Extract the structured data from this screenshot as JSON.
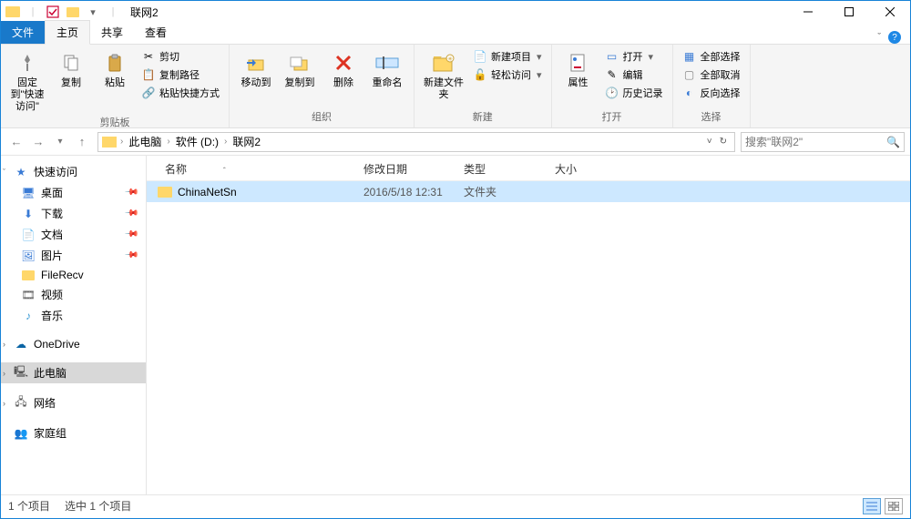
{
  "window": {
    "title": "联网2"
  },
  "tabs": {
    "file": "文件",
    "home": "主页",
    "share": "共享",
    "view": "查看"
  },
  "ribbon": {
    "clipboard": {
      "pin": "固定到\"快速访问\"",
      "copy": "复制",
      "paste": "粘贴",
      "cut": "剪切",
      "copy_path": "复制路径",
      "paste_shortcut": "粘贴快捷方式",
      "label": "剪贴板"
    },
    "organize": {
      "move_to": "移动到",
      "copy_to": "复制到",
      "delete": "删除",
      "rename": "重命名",
      "label": "组织"
    },
    "new": {
      "new_folder": "新建文件夹",
      "new_item": "新建项目",
      "easy_access": "轻松访问",
      "label": "新建"
    },
    "open": {
      "properties": "属性",
      "open": "打开",
      "edit": "编辑",
      "history": "历史记录",
      "label": "打开"
    },
    "select": {
      "select_all": "全部选择",
      "select_none": "全部取消",
      "invert": "反向选择",
      "label": "选择"
    }
  },
  "breadcrumb": {
    "pc": "此电脑",
    "drive": "软件 (D:)",
    "folder": "联网2"
  },
  "search": {
    "placeholder": "搜索\"联网2\""
  },
  "sidebar": {
    "quick_access": "快速访问",
    "desktop": "桌面",
    "downloads": "下载",
    "documents": "文档",
    "pictures": "图片",
    "filerecv": "FileRecv",
    "videos": "视频",
    "music": "音乐",
    "onedrive": "OneDrive",
    "this_pc": "此电脑",
    "network": "网络",
    "homegroup": "家庭组"
  },
  "columns": {
    "name": "名称",
    "date": "修改日期",
    "type": "类型",
    "size": "大小"
  },
  "files": [
    {
      "name": "ChinaNetSn",
      "date": "2016/5/18 12:31",
      "type": "文件夹",
      "size": ""
    }
  ],
  "status": {
    "count": "1 个项目",
    "selected": "选中 1 个项目"
  }
}
